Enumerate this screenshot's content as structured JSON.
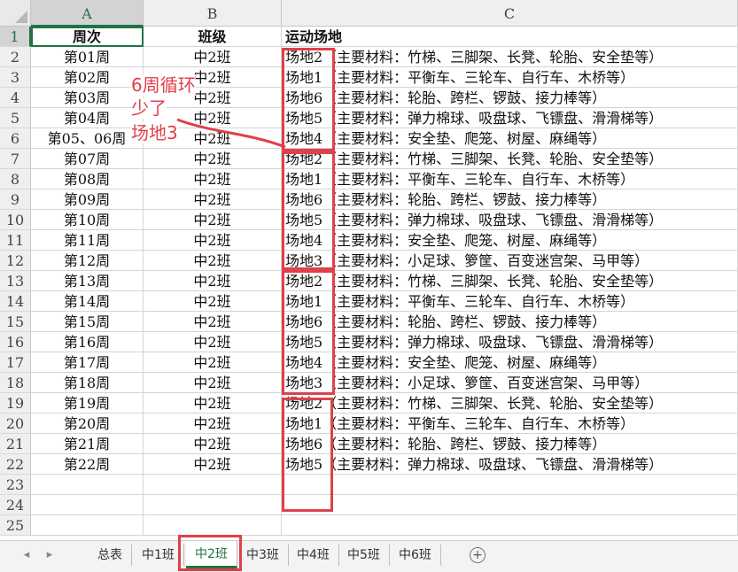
{
  "columns": [
    "A",
    "B",
    "C"
  ],
  "rows": [
    {
      "n": "1",
      "a": "周次",
      "b": "班级",
      "c": "运动场地"
    },
    {
      "n": "2",
      "a": "第01周",
      "b": "中2班",
      "c": "场地2（主要材料：竹梯、三脚架、长凳、轮胎、安全垫等）"
    },
    {
      "n": "3",
      "a": "第02周",
      "b": "中2班",
      "c": "场地1（主要材料：平衡车、三轮车、自行车、木桥等）"
    },
    {
      "n": "4",
      "a": "第03周",
      "b": "中2班",
      "c": "场地6（主要材料：轮胎、跨栏、锣鼓、接力棒等）"
    },
    {
      "n": "5",
      "a": "第04周",
      "b": "中2班",
      "c": "场地5（主要材料：弹力棉球、吸盘球、飞镖盘、滑滑梯等）"
    },
    {
      "n": "6",
      "a": "第05、06周",
      "b": "中2班",
      "c": "场地4（主要材料：安全垫、爬笼、树屋、麻绳等）"
    },
    {
      "n": "7",
      "a": "第07周",
      "b": "中2班",
      "c": "场地2（主要材料：竹梯、三脚架、长凳、轮胎、安全垫等）"
    },
    {
      "n": "8",
      "a": "第08周",
      "b": "中2班",
      "c": "场地1（主要材料：平衡车、三轮车、自行车、木桥等）"
    },
    {
      "n": "9",
      "a": "第09周",
      "b": "中2班",
      "c": "场地6（主要材料：轮胎、跨栏、锣鼓、接力棒等）"
    },
    {
      "n": "10",
      "a": "第10周",
      "b": "中2班",
      "c": "场地5（主要材料：弹力棉球、吸盘球、飞镖盘、滑滑梯等）"
    },
    {
      "n": "11",
      "a": "第11周",
      "b": "中2班",
      "c": "场地4（主要材料：安全垫、爬笼、树屋、麻绳等）"
    },
    {
      "n": "12",
      "a": "第12周",
      "b": "中2班",
      "c": "场地3（主要材料：小足球、箩筐、百变迷宫架、马甲等）"
    },
    {
      "n": "13",
      "a": "第13周",
      "b": "中2班",
      "c": "场地2（主要材料：竹梯、三脚架、长凳、轮胎、安全垫等）"
    },
    {
      "n": "14",
      "a": "第14周",
      "b": "中2班",
      "c": "场地1（主要材料：平衡车、三轮车、自行车、木桥等）"
    },
    {
      "n": "15",
      "a": "第15周",
      "b": "中2班",
      "c": "场地6（主要材料：轮胎、跨栏、锣鼓、接力棒等）"
    },
    {
      "n": "16",
      "a": "第16周",
      "b": "中2班",
      "c": "场地5（主要材料：弹力棉球、吸盘球、飞镖盘、滑滑梯等）"
    },
    {
      "n": "17",
      "a": "第17周",
      "b": "中2班",
      "c": "场地4（主要材料：安全垫、爬笼、树屋、麻绳等）"
    },
    {
      "n": "18",
      "a": "第18周",
      "b": "中2班",
      "c": "场地3（主要材料：小足球、箩筐、百变迷宫架、马甲等）"
    },
    {
      "n": "19",
      "a": "第19周",
      "b": "中2班",
      "c": "场地2（主要材料：竹梯、三脚架、长凳、轮胎、安全垫等）"
    },
    {
      "n": "20",
      "a": "第20周",
      "b": "中2班",
      "c": "场地1（主要材料：平衡车、三轮车、自行车、木桥等）"
    },
    {
      "n": "21",
      "a": "第21周",
      "b": "中2班",
      "c": "场地6（主要材料：轮胎、跨栏、锣鼓、接力棒等）"
    },
    {
      "n": "22",
      "a": "第22周",
      "b": "中2班",
      "c": "场地5（主要材料：弹力棉球、吸盘球、飞镖盘、滑滑梯等）"
    },
    {
      "n": "23",
      "a": "",
      "b": "",
      "c": ""
    },
    {
      "n": "24",
      "a": "",
      "b": "",
      "c": ""
    },
    {
      "n": "25",
      "a": "",
      "b": "",
      "c": ""
    }
  ],
  "annotation": {
    "line1": "6周循环",
    "line2": "少了",
    "line3": "场地3",
    "color": "#e0404a"
  },
  "tabs": [
    "总表",
    "中1班",
    "中2班",
    "中3班",
    "中4班",
    "中5班",
    "中6班"
  ],
  "active_tab": "中2班",
  "accent_color": "#217346"
}
